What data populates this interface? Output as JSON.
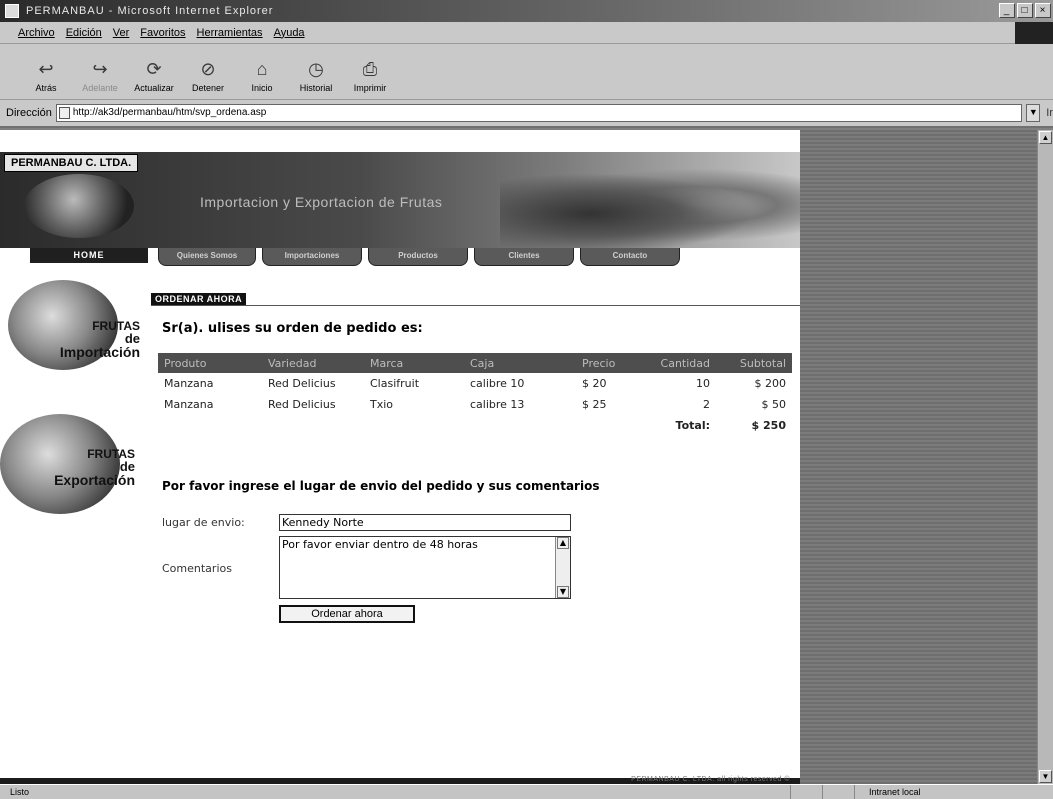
{
  "window": {
    "title": "PERMANBAU - Microsoft Internet Explorer"
  },
  "menu": [
    "Archivo",
    "Edición",
    "Ver",
    "Favoritos",
    "Herramientas",
    "Ayuda"
  ],
  "toolbar": [
    {
      "label": "Atrás",
      "icon": "back-arrow-icon"
    },
    {
      "label": "Adelante",
      "icon": "forward-arrow-icon"
    },
    {
      "label": "Actualizar",
      "icon": "refresh-icon"
    },
    {
      "label": "Detener",
      "icon": "stop-icon"
    },
    {
      "label": "Inicio",
      "icon": "home-icon"
    },
    {
      "label": "Historial",
      "icon": "history-icon"
    },
    {
      "label": "Imprimir",
      "icon": "print-icon"
    }
  ],
  "address": {
    "label": "Dirección",
    "url": "http://ak3d/permanbau/htm/svp_ordena.asp",
    "go": "Ir"
  },
  "site": {
    "logo": "PERMANBAU C. LTDA.",
    "tagline": "Importacion y Exportacion de Frutas",
    "nav": [
      "HOME",
      "Quienes Somos",
      "Importaciones",
      "Productos",
      "Clientes",
      "Contacto"
    ],
    "side_import": [
      "FRUTAS",
      "de",
      "Importación"
    ],
    "side_export": [
      "FRUTAS",
      "de",
      "Exportación"
    ]
  },
  "main": {
    "section": "ORDENAR AHORA",
    "greeting": "Sr(a). ulises su orden de pedido es:",
    "columns": [
      "Produto",
      "Variedad",
      "Marca",
      "Caja",
      "Precio",
      "Cantidad",
      "Subtotal"
    ],
    "rows": [
      [
        "Manzana",
        "Red Delicius",
        "Clasifruit",
        "calibre 10",
        "$ 20",
        "10",
        "$ 200"
      ],
      [
        "Manzana",
        "Red Delicius",
        "Txio",
        "calibre 13",
        "$ 25",
        "2",
        "$ 50"
      ]
    ],
    "total_label": "Total:",
    "total_value": "$ 250",
    "instruction": "Por favor ingrese el lugar de envio del pedido y sus comentarios",
    "place_label": "lugar de envio:",
    "place_value": "Kennedy Norte",
    "comments_label": "Comentarios",
    "comments_value": "Por favor enviar dentro de 48 horas",
    "submit": "Ordenar ahora",
    "footer": "PERMANBAU C. LTDA. all rights reserved ©"
  },
  "status": {
    "left": "Listo",
    "zone": "Intranet local"
  }
}
